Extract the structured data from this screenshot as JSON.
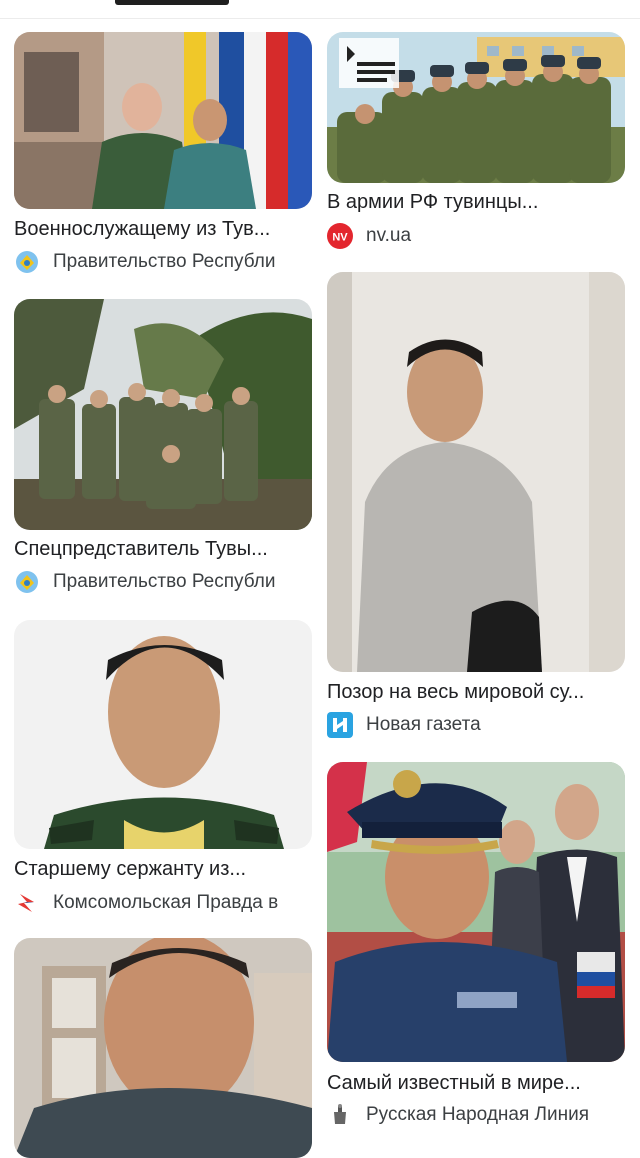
{
  "results": [
    {
      "title": "Военнослужащему из Тув...",
      "source": "Правительство Республи",
      "source_icon": "government-emblem-icon",
      "image": "two-officers-in-uniform-with-flags"
    },
    {
      "title": "В армии РФ тувинцы...",
      "source": "nv.ua",
      "source_icon": "nv-logo-icon",
      "source_badge": "NV",
      "image": "soldiers-group-in-field"
    },
    {
      "title": "Спецпредставитель Тувы...",
      "source": "Правительство Республи",
      "source_icon": "government-emblem-icon",
      "image": "soldiers-group-in-forest"
    },
    {
      "title": "Позор на весь мировой су...",
      "source": "Новая газета",
      "source_icon": "novaya-gazeta-logo-icon",
      "image": "man-in-grey-shirt"
    },
    {
      "title": "Старшему сержанту из...",
      "source": "Комсомольская Правда в",
      "source_icon": "kp-logo-icon",
      "image": "sergeant-portrait"
    },
    {
      "title": "Самый известный в мире...",
      "source": "Русская Народная Линия",
      "source_icon": "rnl-logo-icon",
      "image": "officer-in-blue-cap"
    },
    {
      "title": "",
      "source": "",
      "image": "young-man-selfie"
    }
  ],
  "colors": {
    "nv": "#e3262e",
    "novaya": "#2aa3e1",
    "kp": "#e53935",
    "emblem": "#3d8fd6"
  }
}
